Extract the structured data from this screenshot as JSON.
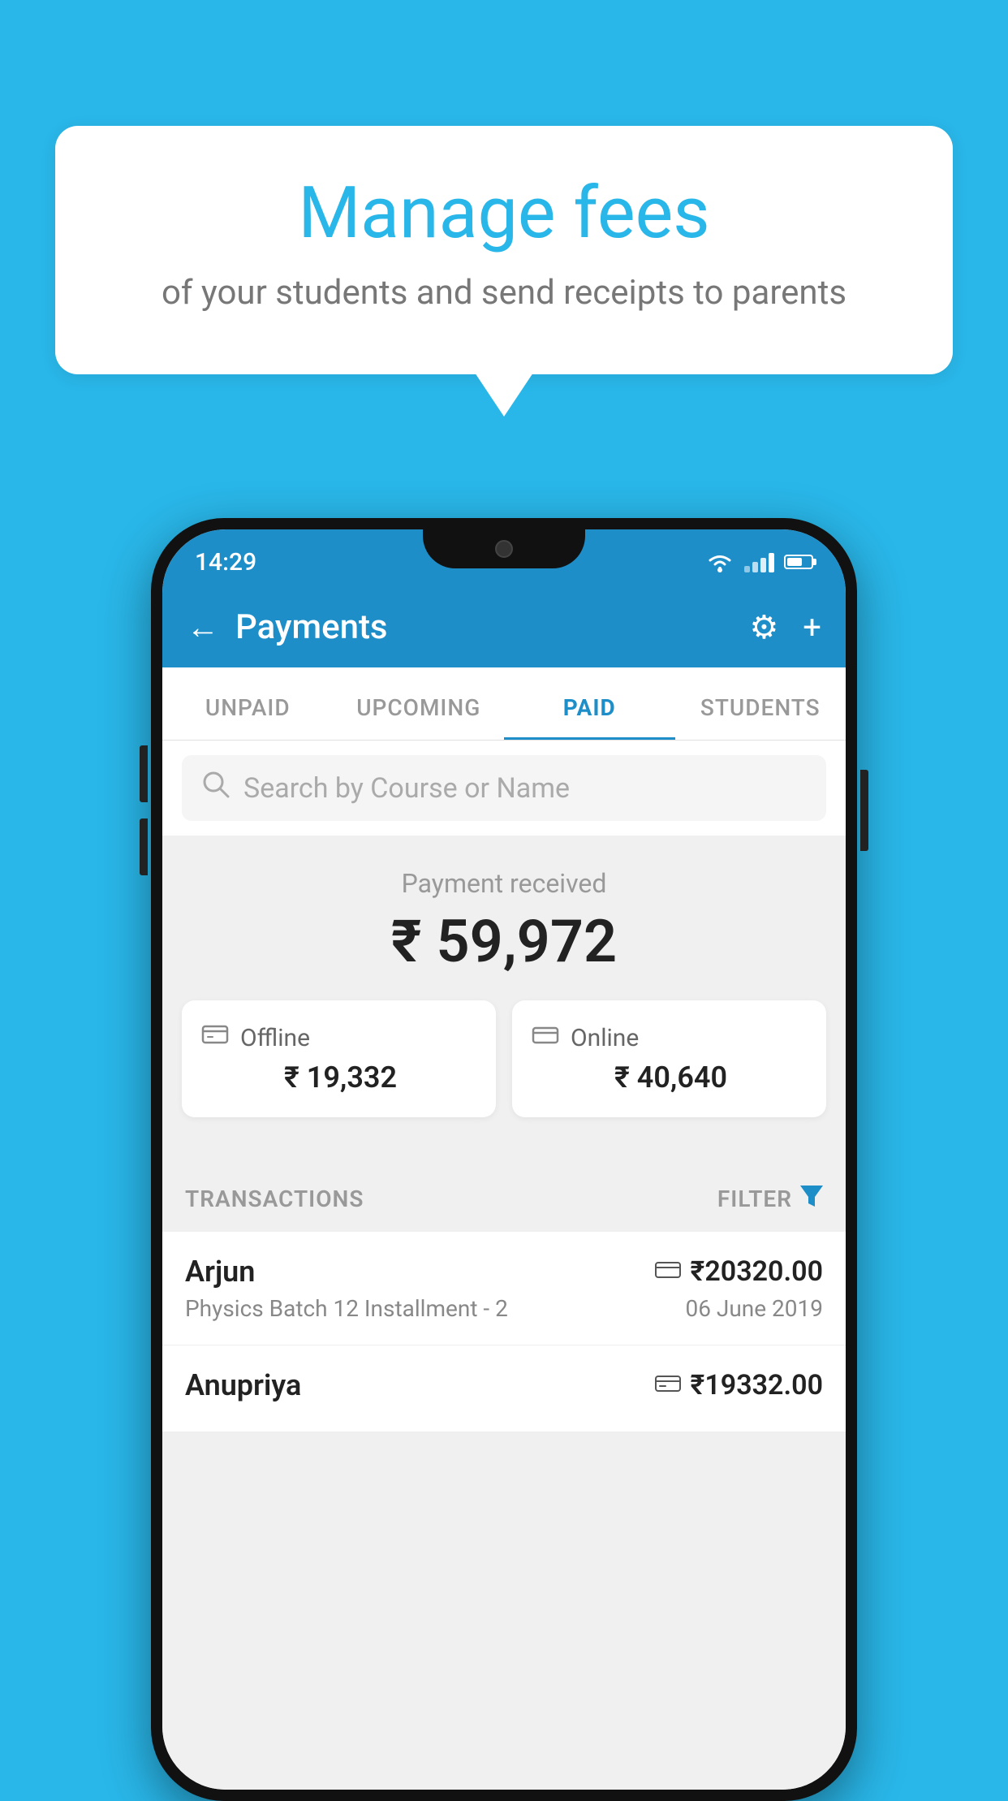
{
  "background_color": "#29b6e8",
  "speech_bubble": {
    "title": "Manage fees",
    "subtitle": "of your students and send receipts to parents"
  },
  "status_bar": {
    "time": "14:29"
  },
  "app_bar": {
    "title": "Payments",
    "back_label": "←",
    "gear_label": "⚙",
    "plus_label": "+"
  },
  "tabs": [
    {
      "label": "UNPAID",
      "active": false
    },
    {
      "label": "UPCOMING",
      "active": false
    },
    {
      "label": "PAID",
      "active": true
    },
    {
      "label": "STUDENTS",
      "active": false
    }
  ],
  "search": {
    "placeholder": "Search by Course or Name"
  },
  "payment_summary": {
    "label": "Payment received",
    "amount": "₹ 59,972",
    "offline": {
      "label": "Offline",
      "amount": "₹ 19,332"
    },
    "online": {
      "label": "Online",
      "amount": "₹ 40,640"
    }
  },
  "transactions": {
    "header_label": "TRANSACTIONS",
    "filter_label": "FILTER",
    "items": [
      {
        "name": "Arjun",
        "course": "Physics Batch 12 Installment - 2",
        "amount": "₹20320.00",
        "date": "06 June 2019",
        "type": "online"
      },
      {
        "name": "Anupriya",
        "course": "",
        "amount": "₹19332.00",
        "date": "",
        "type": "offline"
      }
    ]
  }
}
